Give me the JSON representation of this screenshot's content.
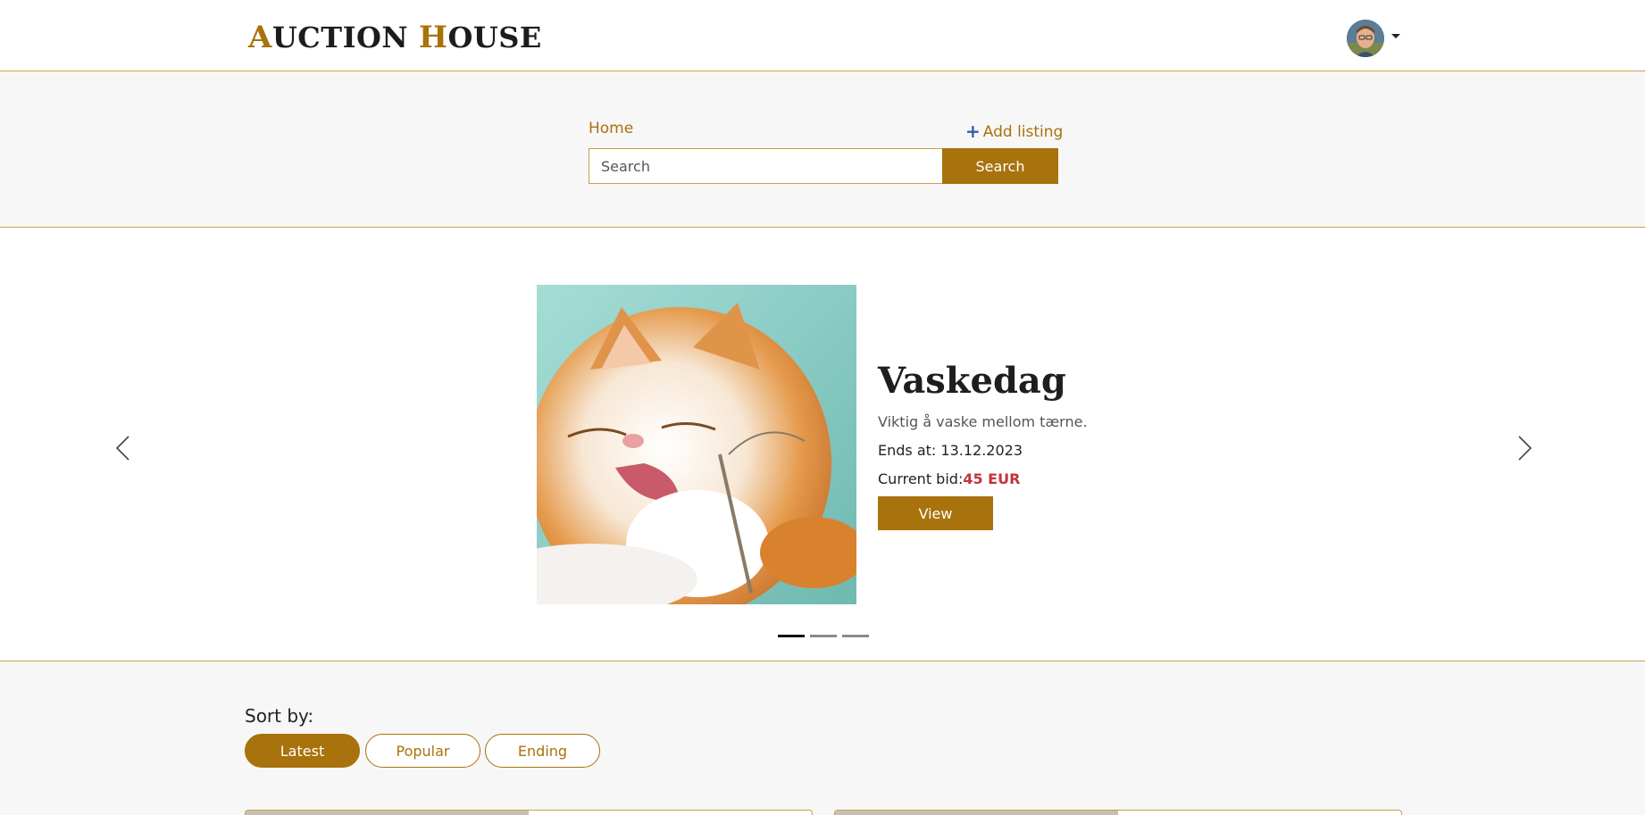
{
  "header": {
    "logo": {
      "a": "A",
      "uction": "UCTION ",
      "h": "H",
      "ouse": "OUSE"
    },
    "avatar_alt": "user avatar"
  },
  "nav": {
    "home_label": "Home",
    "add_listing_label": "Add listing"
  },
  "search": {
    "placeholder": "Search",
    "value": "",
    "button_label": "Search"
  },
  "carousel": {
    "slide": {
      "title": "Vaskedag",
      "description": "Viktig å vaske mellom tærne.",
      "ends_label": "Ends at:",
      "ends_value": "13.12.2023",
      "bid_label": "Current bid:",
      "bid_value": "45 EUR",
      "view_label": "View"
    },
    "indicator_count": 3,
    "active_index": 0
  },
  "sort": {
    "label": "Sort by:",
    "options": [
      {
        "label": "Latest",
        "active": true
      },
      {
        "label": "Popular",
        "active": false
      },
      {
        "label": "Ending",
        "active": false
      }
    ]
  },
  "colors": {
    "accent": "#a8720c",
    "border": "#c8a14a",
    "bid": "#c0343c"
  }
}
